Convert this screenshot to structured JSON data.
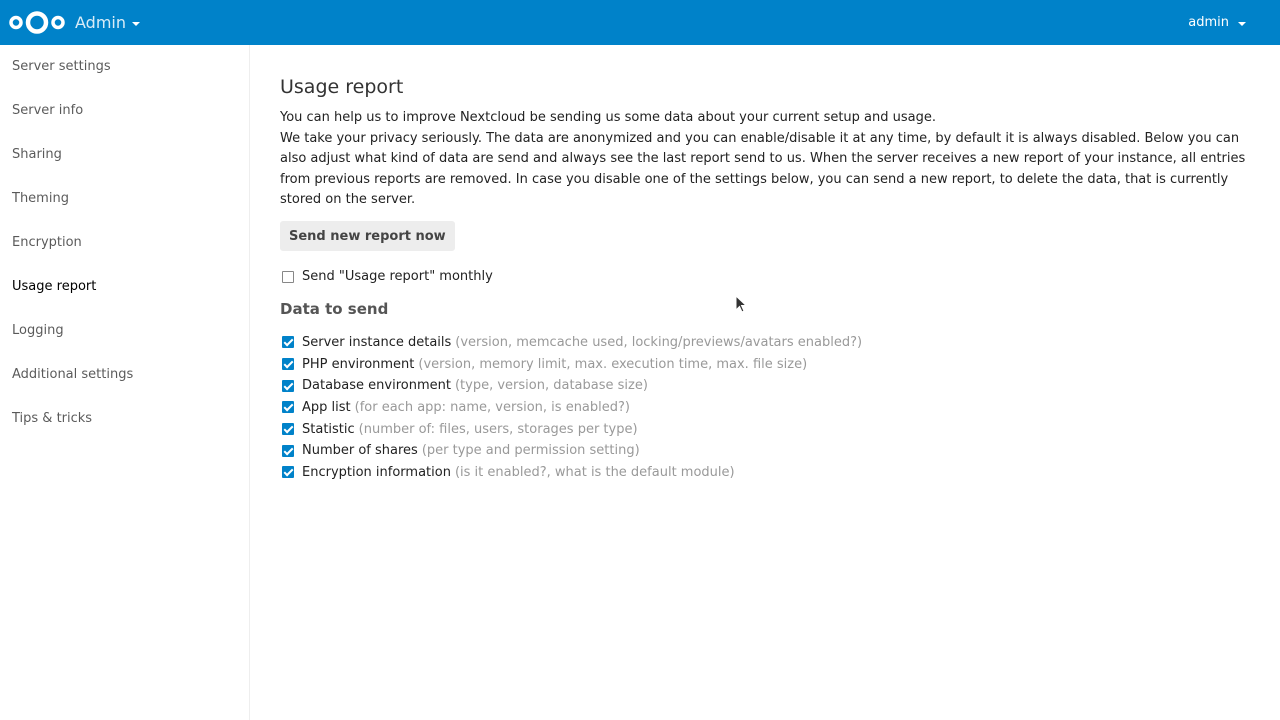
{
  "header": {
    "app_name": "Admin",
    "user": "admin"
  },
  "sidebar": {
    "items": [
      {
        "label": "Server settings",
        "active": false
      },
      {
        "label": "Server info",
        "active": false
      },
      {
        "label": "Sharing",
        "active": false
      },
      {
        "label": "Theming",
        "active": false
      },
      {
        "label": "Encryption",
        "active": false
      },
      {
        "label": "Usage report",
        "active": true
      },
      {
        "label": "Logging",
        "active": false
      },
      {
        "label": "Additional settings",
        "active": false
      },
      {
        "label": "Tips & tricks",
        "active": false
      }
    ]
  },
  "main": {
    "title": "Usage report",
    "intro_line1": "You can help us to improve Nextcloud be sending us some data about your current setup and usage.",
    "intro_line2": "We take your privacy seriously. The data are anonymized and you can enable/disable it at any time, by default it is always disabled. Below you can also adjust what kind of data are send and always see the last report send to us. When the server receives a new report of your instance, all entries from previous reports are removed. In case you disable one of the settings below, you can send a new report, to delete the data, that is currently stored on the server.",
    "send_button": "Send new report now",
    "monthly_label": "Send \"Usage report\" monthly",
    "monthly_checked": false,
    "data_title": "Data to send",
    "data_items": [
      {
        "label": "Server instance details",
        "desc": "(version, memcache used, locking/previews/avatars enabled?)",
        "checked": true
      },
      {
        "label": "PHP environment",
        "desc": "(version, memory limit, max. execution time, max. file size)",
        "checked": true
      },
      {
        "label": "Database environment",
        "desc": "(type, version, database size)",
        "checked": true
      },
      {
        "label": "App list",
        "desc": "(for each app: name, version, is enabled?)",
        "checked": true
      },
      {
        "label": "Statistic",
        "desc": "(number of: files, users, storages per type)",
        "checked": true
      },
      {
        "label": "Number of shares",
        "desc": "(per type and permission setting)",
        "checked": true
      },
      {
        "label": "Encryption information",
        "desc": "(is it enabled?, what is the default module)",
        "checked": true
      }
    ]
  },
  "colors": {
    "brand": "#0082c9"
  }
}
